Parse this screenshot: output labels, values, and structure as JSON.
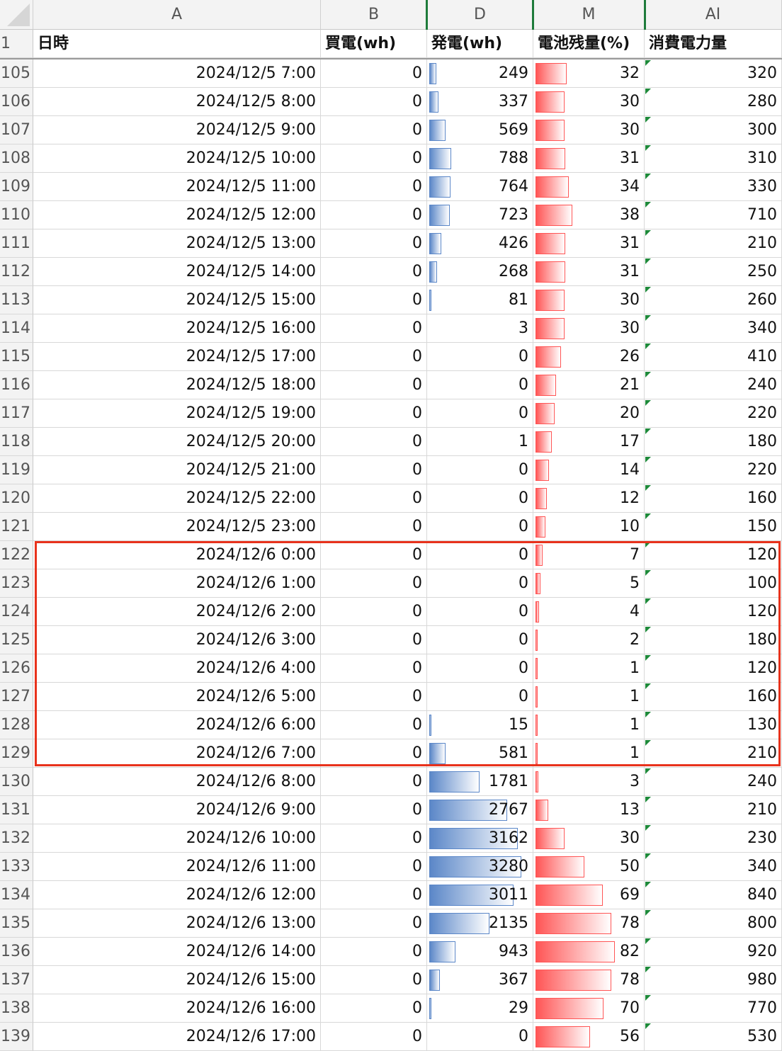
{
  "columns": {
    "corner": "",
    "A": "A",
    "B": "B",
    "D": "D",
    "M": "M",
    "AI": "AI"
  },
  "header_row": {
    "row_number": "1",
    "A": "日時",
    "B": "買電(wh)",
    "D": "発電(wh)",
    "M": "電池残量(%)",
    "AI": "消費電力量"
  },
  "scale": {
    "D_max": 3280,
    "M_max": 100
  },
  "colors": {
    "databar_blue": "#5b87c8",
    "databar_red": "#ff5555",
    "selection_border": "#e8321c",
    "comment_marker": "#1e8a3a"
  },
  "selection": {
    "first_row": "122",
    "last_row": "129"
  },
  "rows": [
    {
      "n": "105",
      "A": "2024/12/5 7:00",
      "B": "0",
      "D": "249",
      "M": "32",
      "AI": "320"
    },
    {
      "n": "106",
      "A": "2024/12/5 8:00",
      "B": "0",
      "D": "337",
      "M": "30",
      "AI": "280"
    },
    {
      "n": "107",
      "A": "2024/12/5 9:00",
      "B": "0",
      "D": "569",
      "M": "30",
      "AI": "300"
    },
    {
      "n": "108",
      "A": "2024/12/5 10:00",
      "B": "0",
      "D": "788",
      "M": "31",
      "AI": "310"
    },
    {
      "n": "109",
      "A": "2024/12/5 11:00",
      "B": "0",
      "D": "764",
      "M": "34",
      "AI": "330"
    },
    {
      "n": "110",
      "A": "2024/12/5 12:00",
      "B": "0",
      "D": "723",
      "M": "38",
      "AI": "710"
    },
    {
      "n": "111",
      "A": "2024/12/5 13:00",
      "B": "0",
      "D": "426",
      "M": "31",
      "AI": "210"
    },
    {
      "n": "112",
      "A": "2024/12/5 14:00",
      "B": "0",
      "D": "268",
      "M": "31",
      "AI": "250"
    },
    {
      "n": "113",
      "A": "2024/12/5 15:00",
      "B": "0",
      "D": "81",
      "M": "30",
      "AI": "260"
    },
    {
      "n": "114",
      "A": "2024/12/5 16:00",
      "B": "0",
      "D": "3",
      "M": "30",
      "AI": "340"
    },
    {
      "n": "115",
      "A": "2024/12/5 17:00",
      "B": "0",
      "D": "0",
      "M": "26",
      "AI": "410"
    },
    {
      "n": "116",
      "A": "2024/12/5 18:00",
      "B": "0",
      "D": "0",
      "M": "21",
      "AI": "240"
    },
    {
      "n": "117",
      "A": "2024/12/5 19:00",
      "B": "0",
      "D": "0",
      "M": "20",
      "AI": "220"
    },
    {
      "n": "118",
      "A": "2024/12/5 20:00",
      "B": "0",
      "D": "1",
      "M": "17",
      "AI": "180"
    },
    {
      "n": "119",
      "A": "2024/12/5 21:00",
      "B": "0",
      "D": "0",
      "M": "14",
      "AI": "220"
    },
    {
      "n": "120",
      "A": "2024/12/5 22:00",
      "B": "0",
      "D": "0",
      "M": "12",
      "AI": "160"
    },
    {
      "n": "121",
      "A": "2024/12/5 23:00",
      "B": "0",
      "D": "0",
      "M": "10",
      "AI": "150"
    },
    {
      "n": "122",
      "A": "2024/12/6 0:00",
      "B": "0",
      "D": "0",
      "M": "7",
      "AI": "120"
    },
    {
      "n": "123",
      "A": "2024/12/6 1:00",
      "B": "0",
      "D": "0",
      "M": "5",
      "AI": "100"
    },
    {
      "n": "124",
      "A": "2024/12/6 2:00",
      "B": "0",
      "D": "0",
      "M": "4",
      "AI": "120"
    },
    {
      "n": "125",
      "A": "2024/12/6 3:00",
      "B": "0",
      "D": "0",
      "M": "2",
      "AI": "180"
    },
    {
      "n": "126",
      "A": "2024/12/6 4:00",
      "B": "0",
      "D": "0",
      "M": "1",
      "AI": "120"
    },
    {
      "n": "127",
      "A": "2024/12/6 5:00",
      "B": "0",
      "D": "0",
      "M": "1",
      "AI": "160"
    },
    {
      "n": "128",
      "A": "2024/12/6 6:00",
      "B": "0",
      "D": "15",
      "M": "1",
      "AI": "130"
    },
    {
      "n": "129",
      "A": "2024/12/6 7:00",
      "B": "0",
      "D": "581",
      "M": "1",
      "AI": "210"
    },
    {
      "n": "130",
      "A": "2024/12/6 8:00",
      "B": "0",
      "D": "1781",
      "M": "3",
      "AI": "240"
    },
    {
      "n": "131",
      "A": "2024/12/6 9:00",
      "B": "0",
      "D": "2767",
      "M": "13",
      "AI": "210"
    },
    {
      "n": "132",
      "A": "2024/12/6 10:00",
      "B": "0",
      "D": "3162",
      "M": "30",
      "AI": "230"
    },
    {
      "n": "133",
      "A": "2024/12/6 11:00",
      "B": "0",
      "D": "3280",
      "M": "50",
      "AI": "340"
    },
    {
      "n": "134",
      "A": "2024/12/6 12:00",
      "B": "0",
      "D": "3011",
      "M": "69",
      "AI": "840"
    },
    {
      "n": "135",
      "A": "2024/12/6 13:00",
      "B": "0",
      "D": "2135",
      "M": "78",
      "AI": "800"
    },
    {
      "n": "136",
      "A": "2024/12/6 14:00",
      "B": "0",
      "D": "943",
      "M": "82",
      "AI": "920"
    },
    {
      "n": "137",
      "A": "2024/12/6 15:00",
      "B": "0",
      "D": "367",
      "M": "78",
      "AI": "980"
    },
    {
      "n": "138",
      "A": "2024/12/6 16:00",
      "B": "0",
      "D": "29",
      "M": "70",
      "AI": "770"
    },
    {
      "n": "139",
      "A": "2024/12/6 17:00",
      "B": "0",
      "D": "0",
      "M": "56",
      "AI": "530"
    }
  ]
}
